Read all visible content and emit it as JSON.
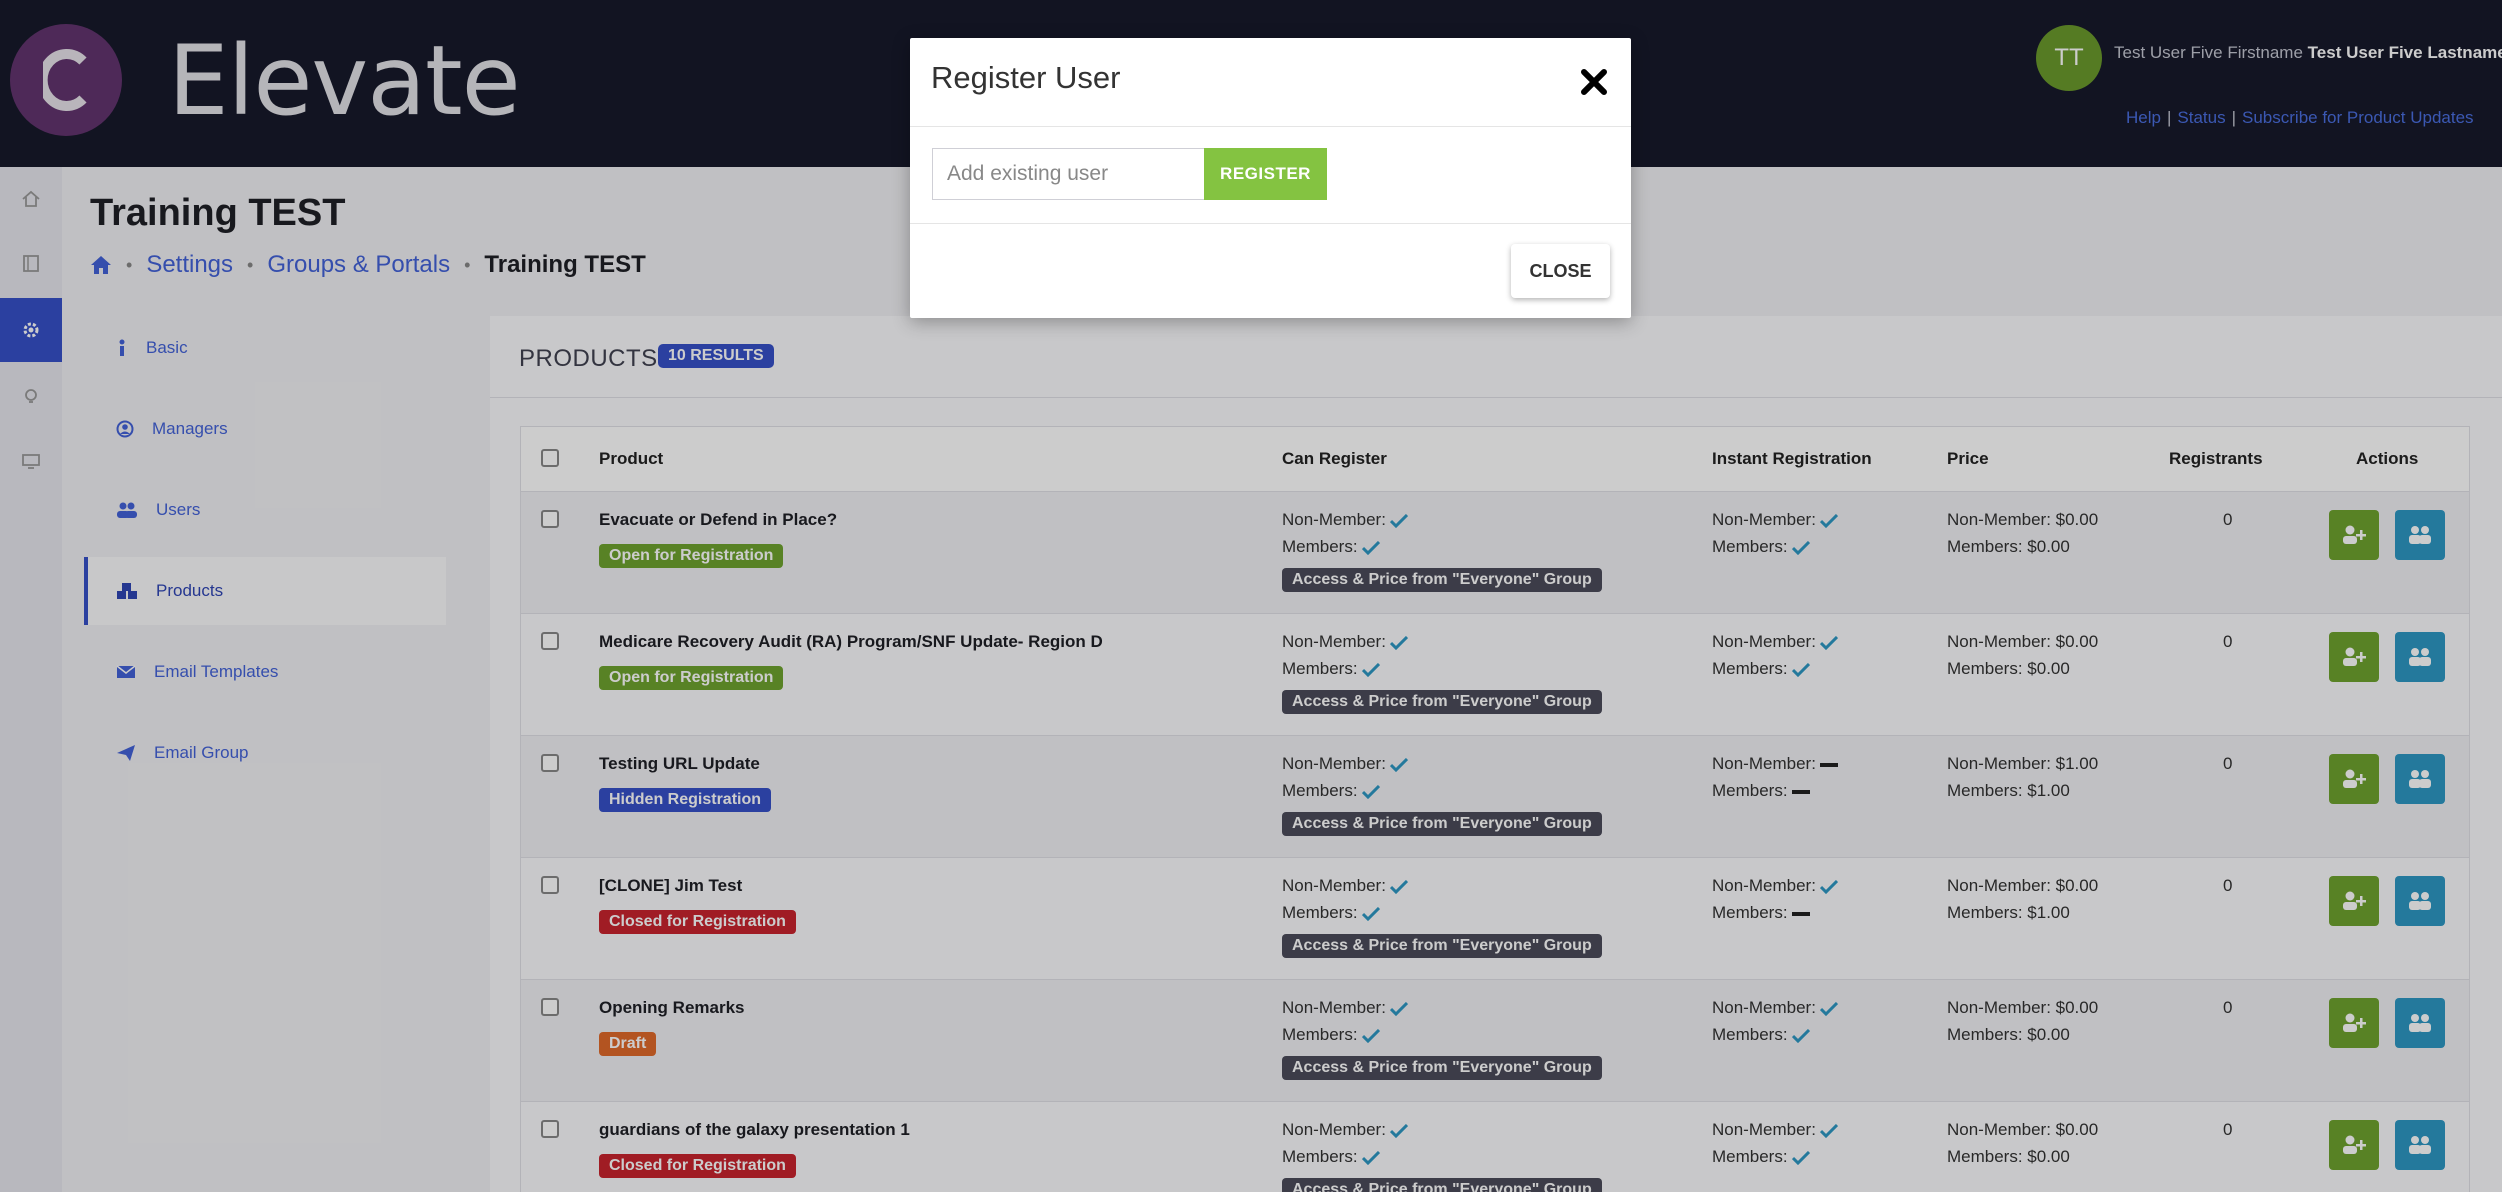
{
  "header": {
    "logo_letter": "C",
    "logo_text": "Elevate",
    "user_initials": "TT",
    "user_first": "Test User Five Firstname",
    "user_full": "Test User Five Lastname",
    "links": [
      "Help",
      "Status",
      "Subscribe for Product Updates"
    ]
  },
  "rail": {
    "icons": [
      "home-icon",
      "book-icon",
      "gear-icon",
      "lightbulb-icon",
      "monitor-icon"
    ],
    "active_index": 2
  },
  "page": {
    "title": "Training TEST",
    "breadcrumb": [
      "Settings",
      "Groups & Portals",
      "Training TEST"
    ]
  },
  "subnav": [
    {
      "label": "Basic",
      "icon": "info-icon"
    },
    {
      "label": "Managers",
      "icon": "user-circle-icon"
    },
    {
      "label": "Users",
      "icon": "users-icon"
    },
    {
      "label": "Products",
      "icon": "cubes-icon",
      "active": true
    },
    {
      "label": "Email Templates",
      "icon": "envelope-icon"
    },
    {
      "label": "Email Group",
      "icon": "paper-plane-icon"
    }
  ],
  "products": {
    "title": "PRODUCTS",
    "results_badge": "10 RESULTS",
    "columns": [
      "Product",
      "Can Register",
      "Instant Registration",
      "Price",
      "Registrants",
      "Actions"
    ],
    "labels": {
      "non_member": "Non-Member:",
      "members": "Members:",
      "access": "Access & Price from \"Everyone\" Group"
    },
    "rows": [
      {
        "name": "Evacuate or Defend in Place?",
        "status": "Open for Registration",
        "status_color": "#6fa32f",
        "can_nm": true,
        "can_m": true,
        "inst_nm": true,
        "inst_m": true,
        "price_nm": "Non-Member: $0.00",
        "price_m": "Members: $0.00",
        "registrants": "0"
      },
      {
        "name": "Medicare Recovery Audit (RA) Program/SNF Update- Region D",
        "status": "Open for Registration",
        "status_color": "#6fa32f",
        "can_nm": true,
        "can_m": true,
        "inst_nm": true,
        "inst_m": true,
        "price_nm": "Non-Member: $0.00",
        "price_m": "Members: $0.00",
        "registrants": "0"
      },
      {
        "name": "Testing URL Update",
        "status": "Hidden Registration",
        "status_color": "#3651c8",
        "can_nm": true,
        "can_m": true,
        "inst_nm": false,
        "inst_m": false,
        "price_nm": "Non-Member: $1.00",
        "price_m": "Members: $1.00",
        "registrants": "0"
      },
      {
        "name": "[CLONE] Jim Test",
        "status": "Closed for Registration",
        "status_color": "#c8242e",
        "can_nm": true,
        "can_m": true,
        "inst_nm": true,
        "inst_m": false,
        "price_nm": "Non-Member: $0.00",
        "price_m": "Members: $1.00",
        "registrants": "0"
      },
      {
        "name": "Opening Remarks",
        "status": "Draft",
        "status_color": "#e06a2a",
        "can_nm": true,
        "can_m": true,
        "inst_nm": true,
        "inst_m": true,
        "price_nm": "Non-Member: $0.00",
        "price_m": "Members: $0.00",
        "registrants": "0"
      },
      {
        "name": "guardians of the galaxy presentation 1",
        "status": "Closed for Registration",
        "status_color": "#c8242e",
        "can_nm": true,
        "can_m": true,
        "inst_nm": true,
        "inst_m": true,
        "price_nm": "Non-Member: $0.00",
        "price_m": "Members: $0.00",
        "registrants": "0"
      }
    ]
  },
  "modal": {
    "title": "Register User",
    "input_placeholder": "Add existing user",
    "register_label": "REGISTER",
    "close_label": "CLOSE"
  },
  "colors": {
    "accent": "#3651c8",
    "register_green": "#84c341",
    "header_bg": "#17192b"
  }
}
